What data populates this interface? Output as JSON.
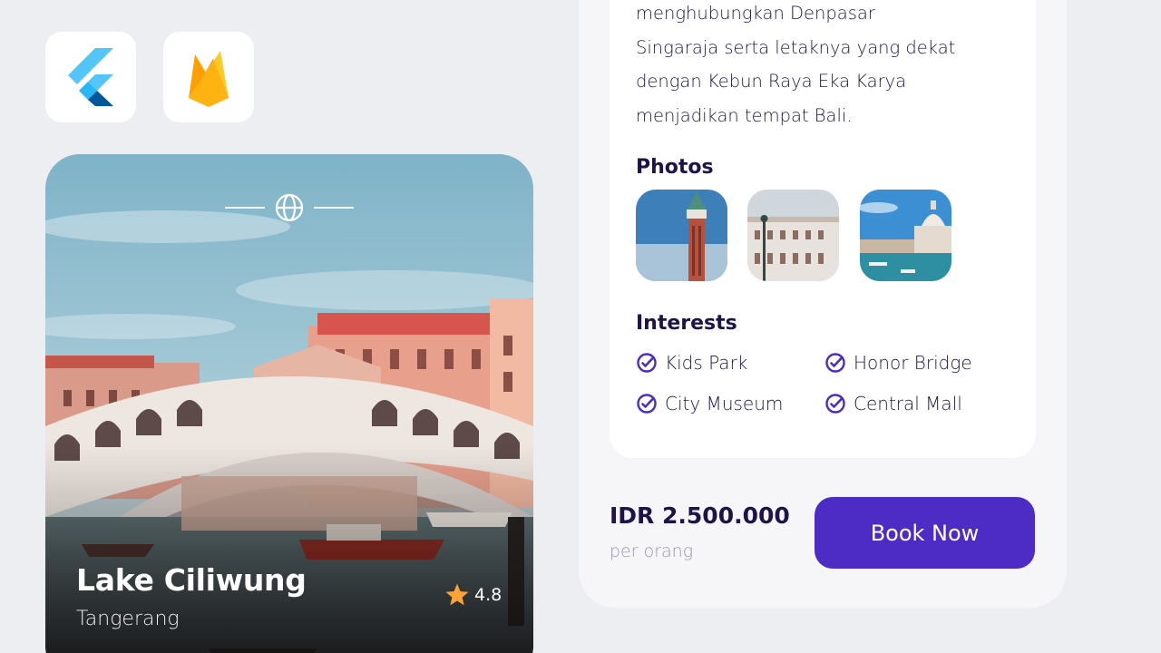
{
  "badges": [
    {
      "name": "flutter-logo-icon"
    },
    {
      "name": "firebase-logo-icon"
    }
  ],
  "destination": {
    "name": "Lake Ciliwung",
    "city": "Tangerang",
    "rating": "4.8"
  },
  "detail": {
    "about_lines": [
      "menghubungkan Denpasar",
      "Singaraja serta letaknya yang dekat",
      "dengan Kebun Raya Eka Karya",
      "menjadikan tempat Bali."
    ],
    "photos_title": "Photos",
    "interests_title": "Interests",
    "interests": [
      "Kids Park",
      "Honor Bridge",
      "City Museum",
      "Central Mall"
    ],
    "price": "IDR 2.500.000",
    "price_unit": "per orang",
    "book_label": "Book Now"
  },
  "colors": {
    "background": "#EDEEF2",
    "primary": "#4C2CC4",
    "text_dark": "#1F1449",
    "text_muted": "#9698A9",
    "star": "#FFA235"
  }
}
